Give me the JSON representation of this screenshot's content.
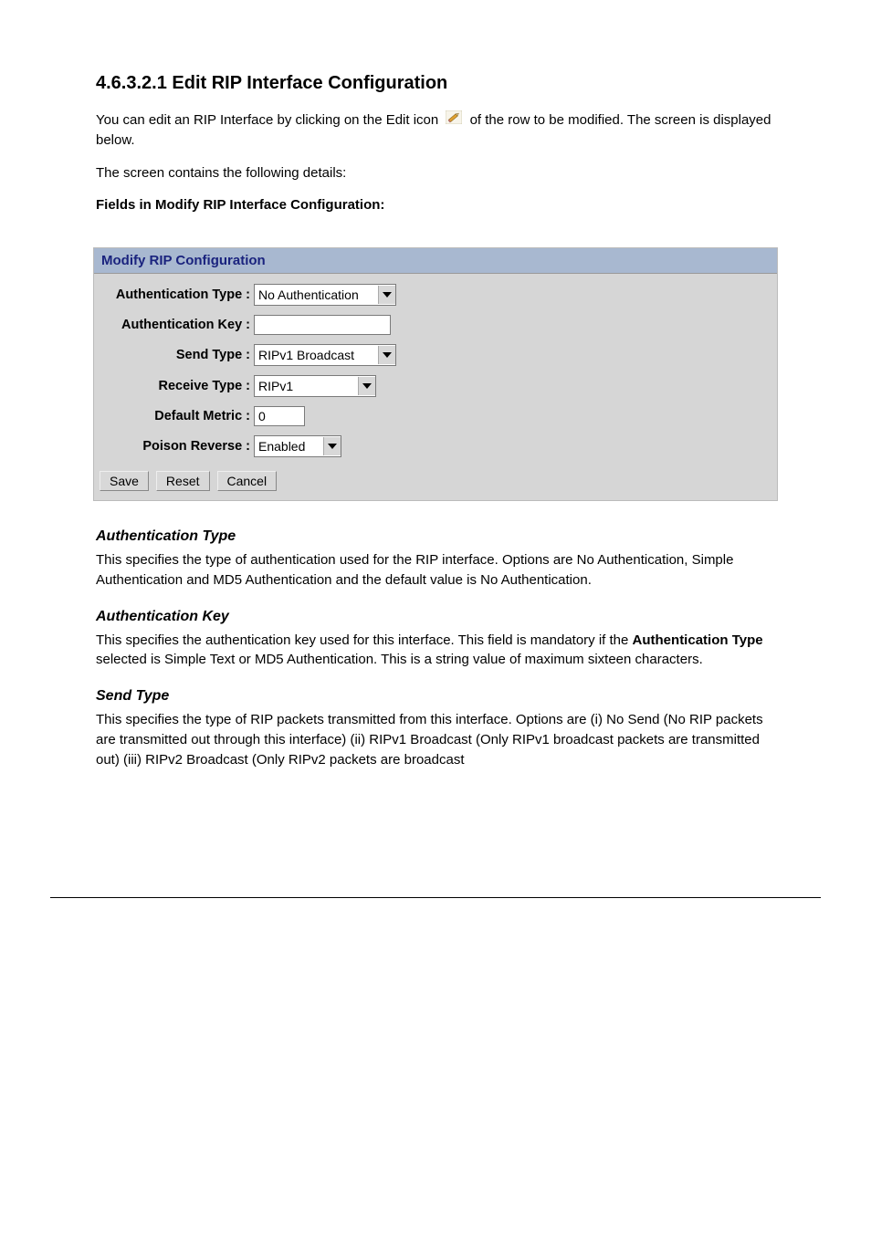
{
  "section_title": "4.6.3.2.1 Edit RIP Interface Configuration",
  "intro_para_prefix": "You can edit an RIP Interface by clicking on the Edit icon ",
  "intro_para_suffix": " of the row to be modified. The screen is displayed below.",
  "field_desc_intro": "The screen contains the following details:",
  "fields_heading": "Fields in Modify RIP Interface Configuration:",
  "panel": {
    "title": "Modify RIP Configuration",
    "labels": {
      "auth_type": "Authentication Type :",
      "auth_key": "Authentication Key :",
      "send_type": "Send Type :",
      "receive_type": "Receive Type :",
      "default_metric": "Default Metric :",
      "poison_reverse": "Poison Reverse :"
    },
    "values": {
      "auth_type": "No Authentication",
      "auth_key": "",
      "send_type": "RIPv1 Broadcast",
      "receive_type": "RIPv1",
      "default_metric": "0",
      "poison_reverse": "Enabled"
    },
    "buttons": {
      "save": "Save",
      "reset": "Reset",
      "cancel": "Cancel"
    }
  },
  "docs": {
    "auth_type": {
      "title": "Authentication Type",
      "body": "This specifies the type of authentication used for the RIP interface. Options are No Authentication, Simple Authentication and MD5 Authentication and the default value is No Authentication."
    },
    "auth_key": {
      "title": "Authentication Key",
      "body_prefix": "This specifies the authentication key used for this interface. This field is mandatory if the ",
      "body_bold": "Authentication Type",
      "body_suffix": " selected is Simple Text or MD5 Authentication. This is a string value of maximum sixteen characters."
    },
    "send_type": {
      "title": "Send Type",
      "body": "This specifies the type of RIP packets transmitted from this interface. Options are (i) No Send (No RIP packets are transmitted out through this interface) (ii) RIPv1 Broadcast (Only RIPv1 broadcast packets are transmitted out) (iii) RIPv2 Broadcast (Only RIPv2 packets are broadcast"
    }
  }
}
